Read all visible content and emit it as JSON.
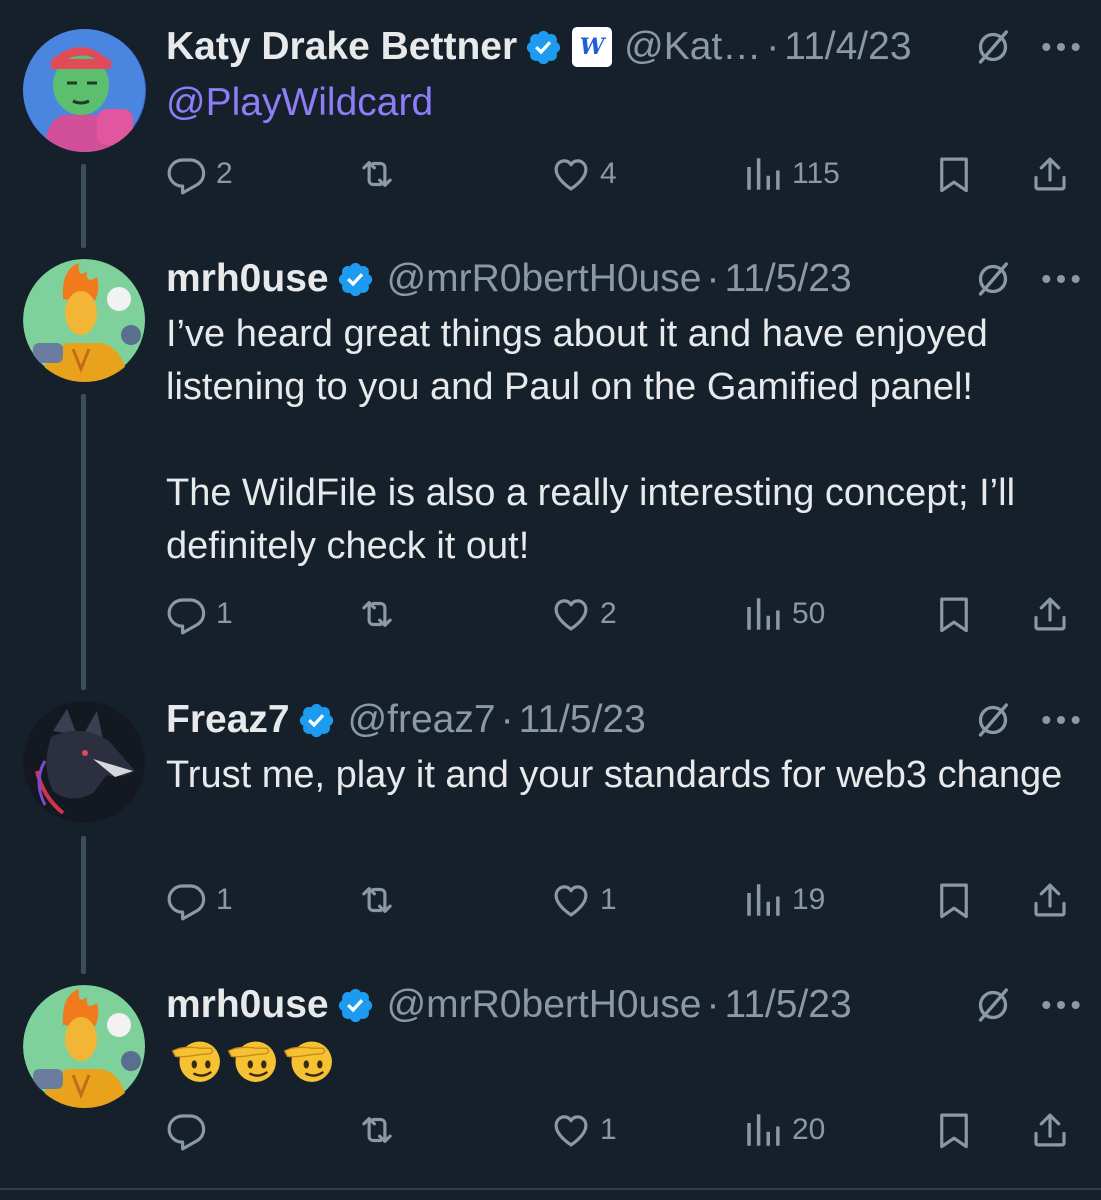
{
  "tweets": [
    {
      "name": "Katy Drake Bettner",
      "handle": "@Kat…",
      "separator": "·",
      "date": "11/4/23",
      "mention": "@PlayWildcard",
      "affiliation_badge": "W",
      "avatar": "green-zombie-character-avatar",
      "actions": {
        "replies": "2",
        "retweets": "",
        "likes": "4",
        "views": "115"
      }
    },
    {
      "name": "mrh0use",
      "handle": "@mrR0bertH0use",
      "separator": "·",
      "date": "11/5/23",
      "text": "I’ve heard great things about it and have enjoyed listening to you and Paul on the Gamified panel!\n\nThe WildFile is also a really interesting concept; I’ll definitely check it out!",
      "avatar": "flaming-hair-character-avatar",
      "actions": {
        "replies": "1",
        "retweets": "",
        "likes": "2",
        "views": "50"
      }
    },
    {
      "name": "Freaz7",
      "handle": "@freaz7",
      "separator": "·",
      "date": "11/5/23",
      "text": "Trust me, play it and your standards for web3 change",
      "avatar": "wolf-avatar",
      "actions": {
        "replies": "1",
        "retweets": "",
        "likes": "1",
        "views": "19"
      }
    },
    {
      "name": "mrh0use",
      "handle": "@mrR0bertH0use",
      "separator": "·",
      "date": "11/5/23",
      "emoji": [
        "saluting-face-emoji",
        "saluting-face-emoji",
        "saluting-face-emoji"
      ],
      "avatar": "flaming-hair-character-avatar",
      "actions": {
        "replies": "",
        "retweets": "",
        "likes": "1",
        "views": "20"
      }
    }
  ],
  "colors": {
    "background": "#15202b",
    "text": "#e7e9ea",
    "secondary": "#8b98a5",
    "verified": "#1d9bf0",
    "mention": "#8f7cf7",
    "thread_line": "#3d4d5c"
  }
}
